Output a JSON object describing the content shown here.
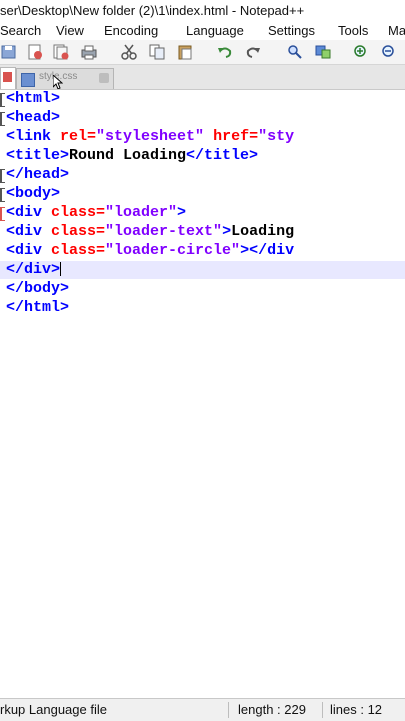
{
  "window": {
    "title": "ser\\Desktop\\New folder (2)\\1\\index.html - Notepad++"
  },
  "menu": [
    {
      "label": "Search"
    },
    {
      "label": "View"
    },
    {
      "label": "Encoding"
    },
    {
      "label": "Language"
    },
    {
      "label": "Settings"
    },
    {
      "label": "Tools"
    },
    {
      "label": "Ma"
    }
  ],
  "tabs": [
    {
      "label": ""
    },
    {
      "label": "style.css"
    }
  ],
  "code": {
    "lines": [
      [
        "<html>"
      ],
      [
        "<head>"
      ],
      [
        "<link ",
        "rel=",
        "\"stylesheet\"",
        " href=",
        "\"sty"
      ],
      [
        "<title>",
        "Round Loading",
        "</title>"
      ],
      [
        "</head>"
      ],
      [
        "<body>"
      ],
      [
        "<div ",
        "class=",
        "\"loader\"",
        ">"
      ],
      [
        "<div ",
        "class=",
        "\"loader-text\"",
        ">",
        "Loading"
      ],
      [
        "<div ",
        "class=",
        "\"loader-circle\"",
        "></div"
      ],
      [
        "</div>"
      ],
      [
        "</body>"
      ],
      [
        "</html>"
      ]
    ]
  },
  "status": {
    "file_type": "rkup Language file",
    "length": "length : 229",
    "lines": "lines : 12"
  },
  "colors": {
    "tag": "#0000ff",
    "attribute": "#ff0000",
    "value": "#8000ff",
    "text": "#000000",
    "current_line": "#e8e8ff"
  }
}
